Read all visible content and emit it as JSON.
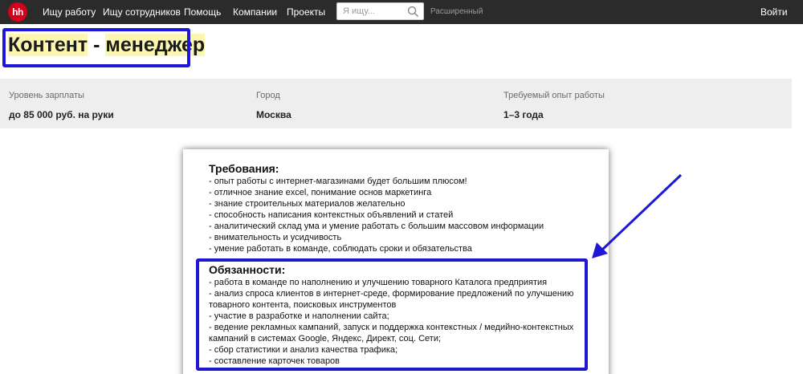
{
  "header": {
    "logo": "hh",
    "nav": [
      "Ищу работу",
      "Ищу сотрудников",
      "Помощь",
      "Компании",
      "Проекты"
    ],
    "search_placeholder": "Я ищу...",
    "advanced": "Расширенный",
    "login": "Войти"
  },
  "vacancy": {
    "title_part1": "Контент",
    "title_sep": " - ",
    "title_part2": "менеджер"
  },
  "info": [
    {
      "label": "Уровень зарплаты",
      "value": "до 85 000 руб. на руки"
    },
    {
      "label": "Город",
      "value": "Москва"
    },
    {
      "label": "Требуемый опыт работы",
      "value": "1–3 года"
    }
  ],
  "requirements": {
    "title": "Требования:",
    "items": [
      "- опыт работы с интернет-магазинами будет большим плюсом!",
      "- отличное знание excel, понимание основ маркетинга",
      "- знание строительных материалов желательно",
      "- способность написания контекстных объявлений и статей",
      "- аналитический склад ума и умение работать с большим массовом информации",
      "- внимательность и усидчивость",
      "- умение работать в команде, соблюдать сроки и обязательства"
    ]
  },
  "duties": {
    "title": "Обязанности:",
    "items": [
      "- работа в команде по наполнению и улучшению товарного Каталога предприятия",
      "- анализ спроса клиентов в интернет-среде, формирование предложений по улучшению",
      "товарного контента, поисковых инструментов",
      "- участие в разработке и наполнении сайта;",
      "- ведение рекламных кампаний, запуск и поддержка контекстных / медийно-контекстных",
      "кампаний в системах Google, Яндекс, Директ, соц. Сети;",
      "- сбор статистики и анализ качества трафика;",
      "- составление карточек товаров"
    ]
  },
  "colors": {
    "header_bg": "#2b2b2b",
    "logo_red": "#d6001c",
    "annotation_blue": "#1f17d6",
    "highlight": "#fbf6b0"
  }
}
